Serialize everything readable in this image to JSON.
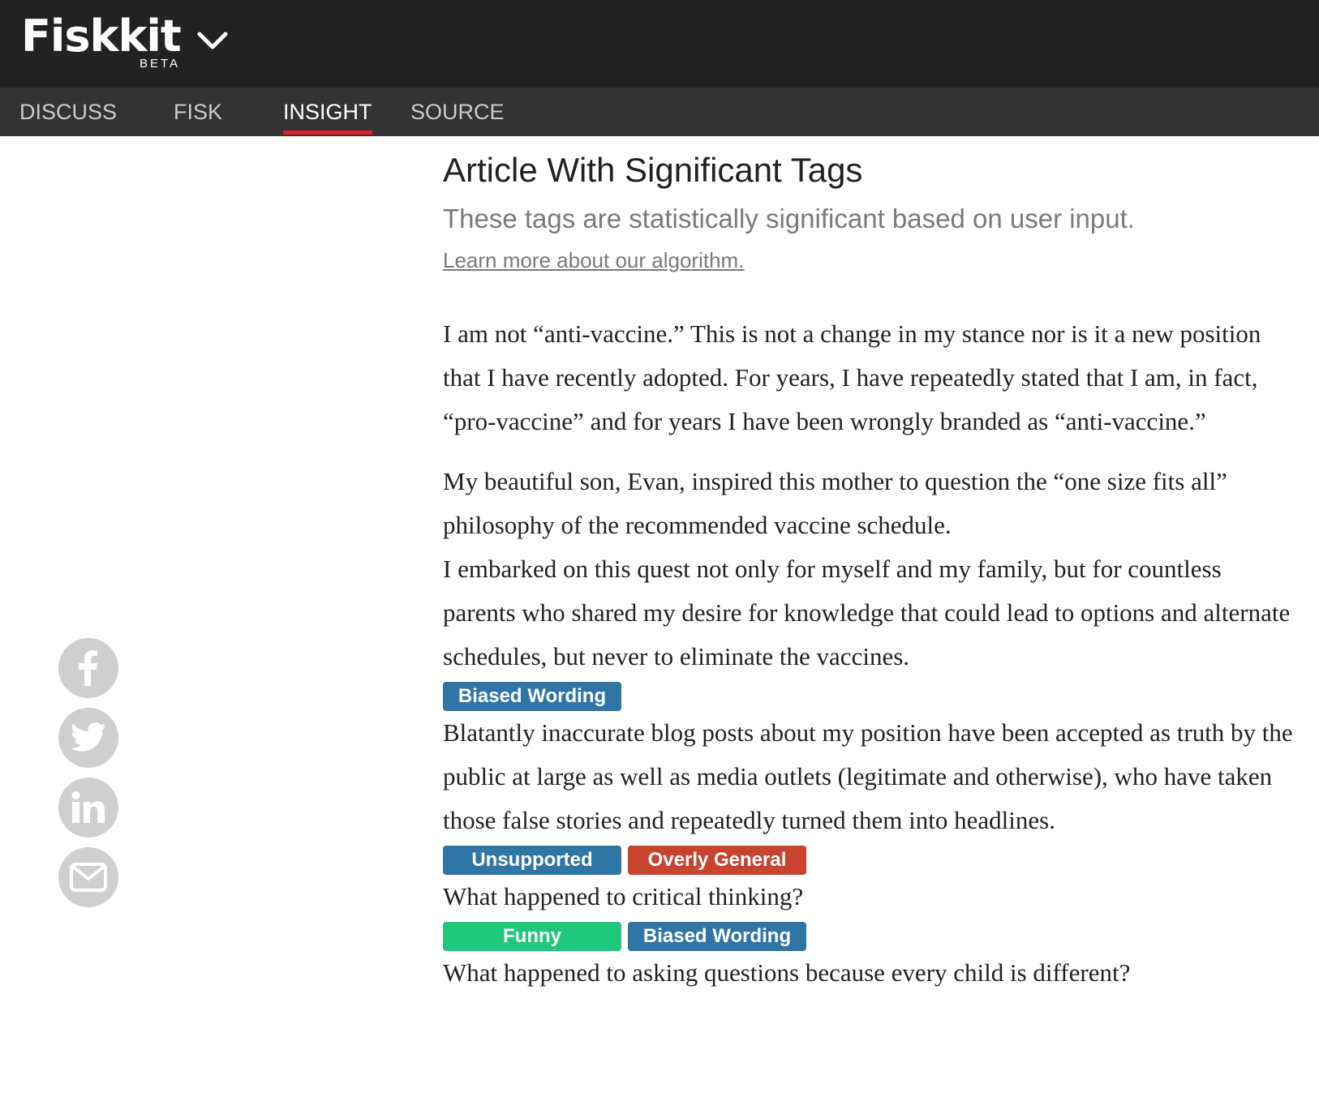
{
  "header": {
    "logo": "Fiskkit",
    "beta": "BETA",
    "menu_icon": "chevron-down-icon"
  },
  "nav": {
    "tabs": [
      {
        "label": "DISCUSS",
        "active": false
      },
      {
        "label": "FISK",
        "active": false
      },
      {
        "label": "INSIGHT",
        "active": true
      },
      {
        "label": "SOURCE",
        "active": false
      }
    ],
    "active_underline_color": "#e31c2b"
  },
  "social": [
    {
      "icon": "facebook-icon"
    },
    {
      "icon": "twitter-icon"
    },
    {
      "icon": "linkedin-icon"
    },
    {
      "icon": "email-icon"
    }
  ],
  "main": {
    "title": "Article With Significant Tags",
    "subtitle": "These tags are statistically significant based on user input.",
    "learn_link": "Learn more about our algorithm.",
    "paragraphs": [
      "I am not “anti-vaccine.” This is not a change in my stance nor is it a new position that I have recently adopted. For years, I have repeatedly stated that I am, in fact, “pro-vaccine” and for years I have been wrongly branded as “anti-vaccine.”",
      "My beautiful son, Evan, inspired this mother to question the “one size fits all” philosophy of the recommended vaccine schedule.",
      "I embarked on this quest not only for myself and my family, but for countless parents who shared my desire for knowledge that could lead to options and alternate schedules, but never to eliminate the vaccines.",
      "Blatantly inaccurate blog posts about my position have been accepted as truth by the public at large as well as media outlets (legitimate and otherwise), who have taken those false stories and repeatedly turned them into headlines.",
      "What happened to critical thinking?",
      "What happened to asking questions because every child is different?"
    ],
    "tags": {
      "after_p3": [
        "Biased Wording"
      ],
      "after_p4": [
        "Unsupported",
        "Overly General"
      ],
      "after_p5": [
        "Funny",
        "Biased Wording"
      ]
    }
  },
  "colors": {
    "topbar": "#222222",
    "navbar": "#333333",
    "tag_blue": "#2f76a7",
    "tag_red": "#c9432e",
    "tag_green": "#20c77c"
  }
}
